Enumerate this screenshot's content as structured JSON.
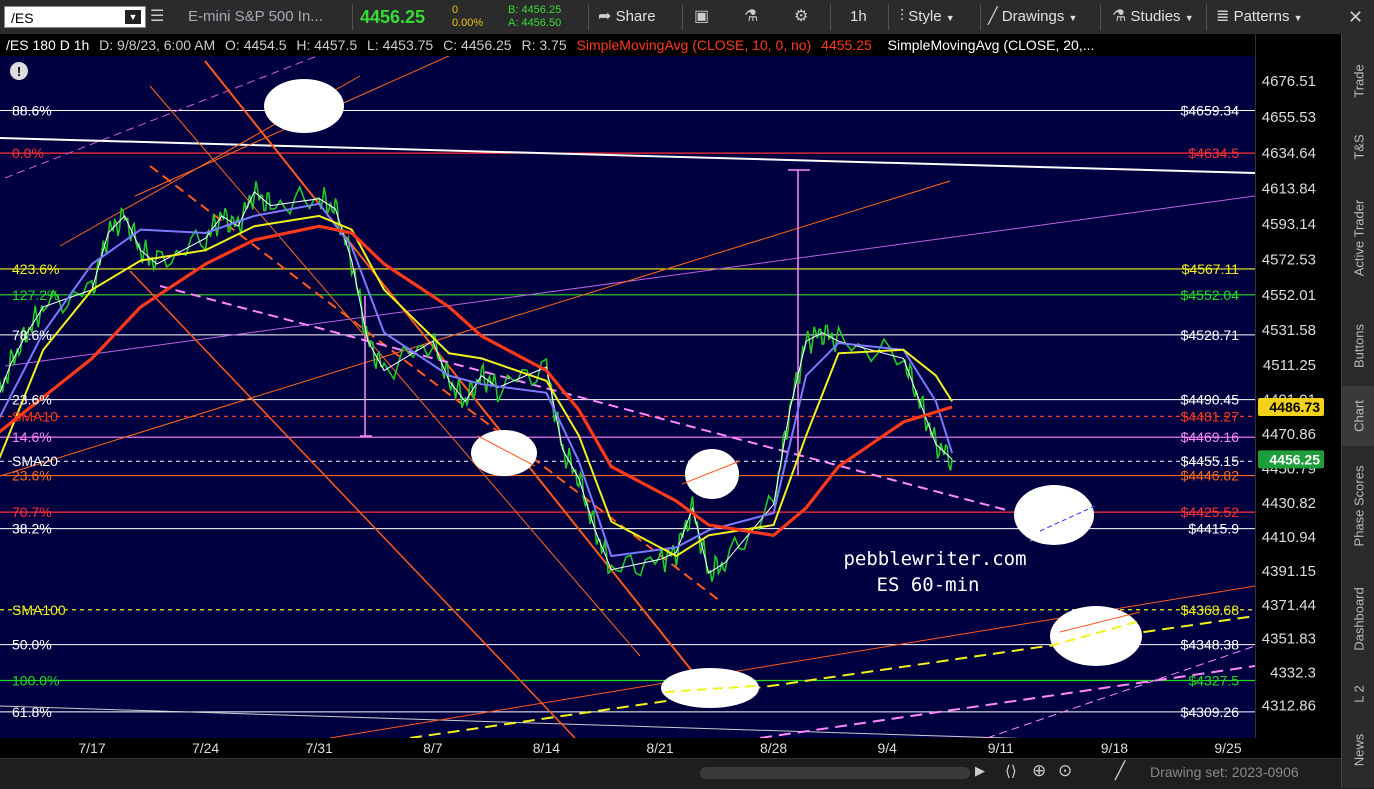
{
  "toolbar": {
    "symbol": "/ES",
    "instrument": "E-mini S&P 500 In...",
    "last": "4456.25",
    "change": "0",
    "change_pct": "0.00%",
    "bid": "B: 4456.25",
    "ask": "A: 4456.50",
    "share_label": "Share",
    "interval_label": "1h",
    "style_label": "Style",
    "drawings_label": "Drawings",
    "studies_label": "Studies",
    "patterns_label": "Patterns"
  },
  "header": {
    "symbol": "/ES 180 D 1h",
    "date": "D: 9/8/23, 6:00 AM",
    "open": "O: 4454.5",
    "high": "H: 4457.5",
    "low": "L: 4453.75",
    "close": "C: 4456.25",
    "range": "R: 3.75",
    "study1": "SimpleMovingAvg (CLOSE, 10, 0, no)",
    "study1_value": "4455.25",
    "study2": "SimpleMovingAvg (CLOSE, 20,..."
  },
  "watermark": {
    "line1": "pebblewriter.com",
    "line2": "ES  60-min"
  },
  "bottom": {
    "drawing_set": "Drawing set: 2023-0906"
  },
  "side_tabs": [
    "Trade",
    "T&S",
    "Active Trader",
    "Buttons",
    "Chart",
    "Phase Scores",
    "Dashboard",
    "L 2",
    "News"
  ],
  "colors": {
    "background": "#000040",
    "sma10": "#ff3a1a",
    "sma20": "#f2f21c",
    "sma_fast": "#7a7aff",
    "price": "#22cc22",
    "last_label": "#1e9e3a",
    "sma_label": "#f2d21c"
  },
  "chart_data": {
    "type": "line",
    "ylim": [
      4300,
      4690
    ],
    "xlim": [
      "7/11",
      "9/25"
    ],
    "y_ticks": [
      4676.51,
      4655.53,
      4634.64,
      4613.84,
      4593.14,
      4572.53,
      4552.01,
      4531.58,
      4511.25,
      4491.01,
      4470.86,
      4450.79,
      4430.82,
      4410.94,
      4391.15,
      4371.44,
      4351.83,
      4332.3,
      4312.86
    ],
    "x_ticks": [
      "7/17",
      "7/24",
      "7/31",
      "8/7",
      "8/14",
      "8/21",
      "8/28",
      "9/4",
      "9/11",
      "9/18",
      "9/25"
    ],
    "last_price": 4456.25,
    "sma10_last": 4486.73,
    "levels": [
      {
        "left": "88.6%",
        "right": "$4659.34",
        "value": 4659.34,
        "color": "#ffffff"
      },
      {
        "left": "0.0%",
        "right": "$4634.5",
        "value": 4634.5,
        "color": "#ff3333"
      },
      {
        "left": "423.6%",
        "right": "$4567.11",
        "value": 4567.11,
        "color": "#f2f21c"
      },
      {
        "left": "127.2%",
        "right": "$4552.04",
        "value": 4552.04,
        "color": "#22dd22"
      },
      {
        "left": "78.6%",
        "right": "$4528.71",
        "value": 4528.71,
        "color": "#ffffff"
      },
      {
        "left": "23.6%",
        "right": "$4490.45",
        "value": 4491.0,
        "color": "#ffffff"
      },
      {
        "left": "SMA10",
        "right": "$4481.27",
        "value": 4481.27,
        "color": "#ff3a1a"
      },
      {
        "left": "14.6%",
        "right": "$4469.16",
        "value": 4469.16,
        "color": "#ff88ff"
      },
      {
        "left": "SMA20",
        "right": "$4455.15",
        "value": 4455.15,
        "color": "#ffffff"
      },
      {
        "left": "23.6%",
        "right": "$4446.82",
        "value": 4446.82,
        "color": "#ff6a1a"
      },
      {
        "left": "70.7%",
        "right": "$4425.52",
        "value": 4425.52,
        "color": "#ff3333"
      },
      {
        "left": "38.2%",
        "right": "$4415.9",
        "value": 4415.9,
        "color": "#ffffff"
      },
      {
        "left": "SMA100",
        "right": "$4368.68",
        "value": 4368.68,
        "color": "#f2f21c"
      },
      {
        "left": "50.0%",
        "right": "$4348.38",
        "value": 4348.38,
        "color": "#ffffff"
      },
      {
        "left": "100.0%",
        "right": "$4327.5",
        "value": 4327.5,
        "color": "#22dd22"
      },
      {
        "left": "61.8%",
        "right": "$4309.26",
        "value": 4309.26,
        "color": "#ffffff"
      }
    ],
    "price_path": [
      [
        "7/11",
        4487
      ],
      [
        "7/12",
        4512
      ],
      [
        "7/13",
        4530
      ],
      [
        "7/14",
        4545
      ],
      [
        "7/17",
        4555
      ],
      [
        "7/18",
        4588
      ],
      [
        "7/19",
        4598
      ],
      [
        "7/20",
        4578
      ],
      [
        "7/21",
        4570
      ],
      [
        "7/24",
        4585
      ],
      [
        "7/25",
        4598
      ],
      [
        "7/26",
        4592
      ],
      [
        "7/27",
        4612
      ],
      [
        "7/28",
        4604
      ],
      [
        "7/31",
        4608
      ],
      [
        "8/1",
        4602
      ],
      [
        "8/2",
        4572
      ],
      [
        "8/3",
        4525
      ],
      [
        "8/4",
        4508
      ],
      [
        "8/7",
        4525
      ],
      [
        "8/8",
        4502
      ],
      [
        "8/9",
        4490
      ],
      [
        "8/10",
        4505
      ],
      [
        "8/11",
        4498
      ],
      [
        "8/14",
        4510
      ],
      [
        "8/15",
        4462
      ],
      [
        "8/16",
        4445
      ],
      [
        "8/17",
        4415
      ],
      [
        "8/18",
        4392
      ],
      [
        "8/21",
        4398
      ],
      [
        "8/22",
        4402
      ],
      [
        "8/23",
        4428
      ],
      [
        "8/24",
        4390
      ],
      [
        "8/25",
        4396
      ],
      [
        "8/28",
        4430
      ],
      [
        "8/29",
        4485
      ],
      [
        "8/30",
        4525
      ],
      [
        "8/31",
        4530
      ],
      [
        "9/1",
        4525
      ],
      [
        "9/5",
        4515
      ],
      [
        "9/6",
        4490
      ],
      [
        "9/7",
        4465
      ],
      [
        "9/8",
        4456.25
      ]
    ],
    "sma10_path": [
      [
        "7/11",
        4470
      ],
      [
        "7/13",
        4485
      ],
      [
        "7/17",
        4515
      ],
      [
        "7/20",
        4545
      ],
      [
        "7/24",
        4570
      ],
      [
        "7/27",
        4584
      ],
      [
        "7/31",
        4592
      ],
      [
        "8/2",
        4588
      ],
      [
        "8/4",
        4570
      ],
      [
        "8/8",
        4545
      ],
      [
        "8/10",
        4528
      ],
      [
        "8/14",
        4508
      ],
      [
        "8/16",
        4485
      ],
      [
        "8/18",
        4452
      ],
      [
        "8/22",
        4432
      ],
      [
        "8/24",
        4418
      ],
      [
        "8/28",
        4412
      ],
      [
        "8/30",
        4428
      ],
      [
        "9/1",
        4452
      ],
      [
        "9/5",
        4478
      ],
      [
        "9/8",
        4486.73
      ]
    ],
    "sma20_path": [
      [
        "7/11",
        4450
      ],
      [
        "7/14",
        4520
      ],
      [
        "7/17",
        4555
      ],
      [
        "7/20",
        4572
      ],
      [
        "7/24",
        4578
      ],
      [
        "7/27",
        4592
      ],
      [
        "7/31",
        4598
      ],
      [
        "8/2",
        4590
      ],
      [
        "8/4",
        4555
      ],
      [
        "8/8",
        4518
      ],
      [
        "8/10",
        4515
      ],
      [
        "8/14",
        4502
      ],
      [
        "8/16",
        4470
      ],
      [
        "8/18",
        4420
      ],
      [
        "8/22",
        4400
      ],
      [
        "8/24",
        4412
      ],
      [
        "8/28",
        4418
      ],
      [
        "8/30",
        4470
      ],
      [
        "9/1",
        4518
      ],
      [
        "9/5",
        4520
      ],
      [
        "9/7",
        4505
      ],
      [
        "9/8",
        4490
      ]
    ],
    "smafast_path": [
      [
        "7/11",
        4475
      ],
      [
        "7/14",
        4530
      ],
      [
        "7/17",
        4570
      ],
      [
        "7/20",
        4590
      ],
      [
        "7/24",
        4588
      ],
      [
        "7/27",
        4598
      ],
      [
        "7/31",
        4605
      ],
      [
        "8/2",
        4580
      ],
      [
        "8/4",
        4530
      ],
      [
        "8/8",
        4505
      ],
      [
        "8/10",
        4500
      ],
      [
        "8/14",
        4495
      ],
      [
        "8/16",
        4455
      ],
      [
        "8/18",
        4400
      ],
      [
        "8/22",
        4405
      ],
      [
        "8/24",
        4415
      ],
      [
        "8/28",
        4425
      ],
      [
        "8/30",
        4505
      ],
      [
        "9/1",
        4524
      ],
      [
        "9/5",
        4520
      ],
      [
        "9/7",
        4490
      ],
      [
        "9/8",
        4460
      ]
    ]
  }
}
